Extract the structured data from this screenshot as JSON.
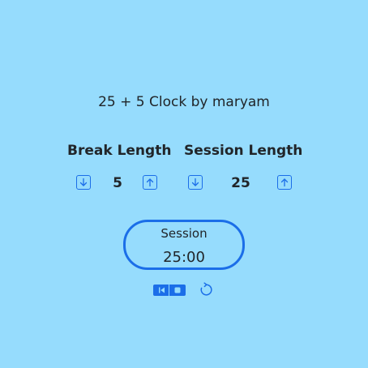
{
  "app": {
    "title": "25 + 5 Clock by maryam",
    "accent_color": "#1b6ee8",
    "background_color": "#96dcfd"
  },
  "break": {
    "label": "Break Length",
    "value": "5",
    "decrement_icon": "arrow-down-square-icon",
    "increment_icon": "arrow-up-square-icon"
  },
  "session": {
    "label": "Session Length",
    "value": "25",
    "decrement_icon": "arrow-down-square-icon",
    "increment_icon": "arrow-up-square-icon"
  },
  "timer": {
    "label": "Session",
    "time": "25:00"
  },
  "controls": {
    "play_pause_icon": "play-pause-icon",
    "reset_icon": "reset-icon"
  }
}
